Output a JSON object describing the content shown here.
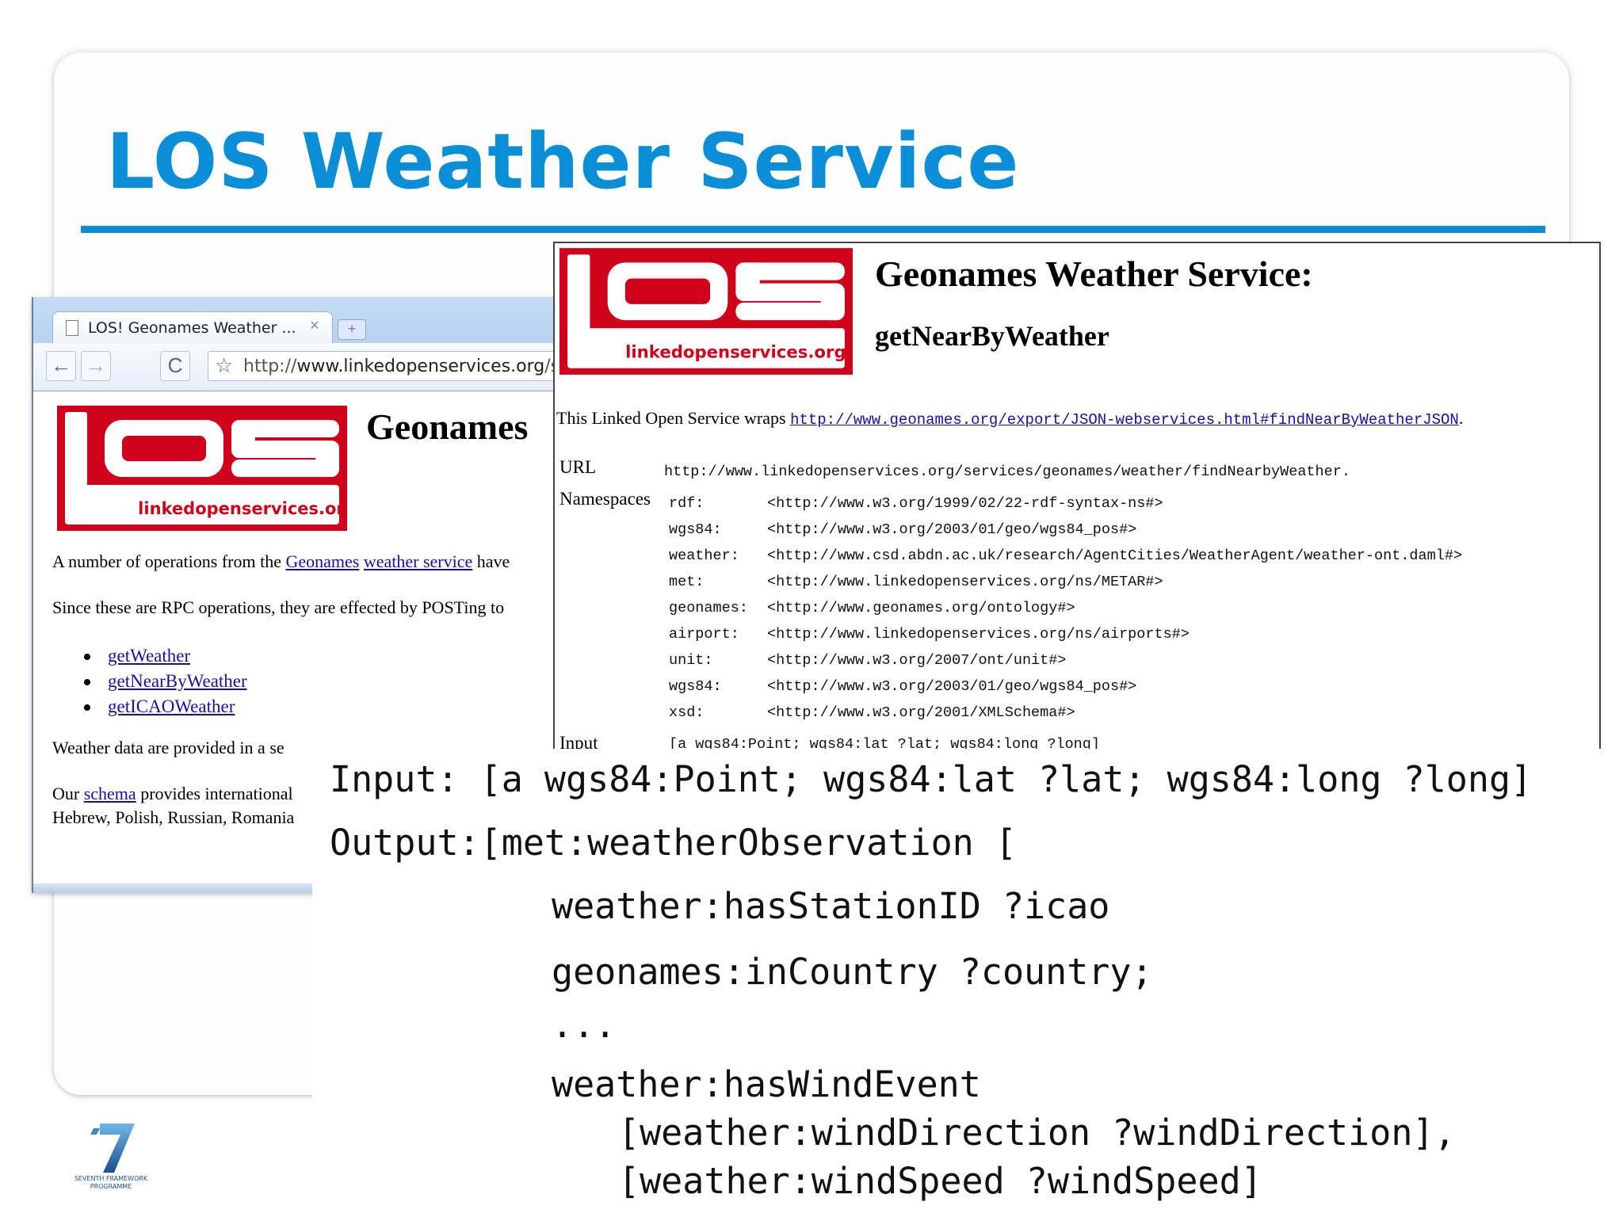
{
  "slide": {
    "title": "LOS Weather Service"
  },
  "browser": {
    "tab_title": "LOS! Geonames Weather ...",
    "tab_close": "×",
    "new_tab": "+",
    "back": "←",
    "forward": "→",
    "reload": "C",
    "star": "☆",
    "url_prefix": "http://",
    "url_domain": "www.linkedopenservices.org",
    "url_rest": "/servic",
    "page_heading": "Geonames",
    "logo_text": "linkedopenservices.org",
    "para1_start": "A number of operations from the ",
    "para1_link1": "Geonames",
    "para1_link2": "weather service",
    "para1_end": " have",
    "para2": "Since these are RPC operations, they are effected by POSTing to",
    "operations": [
      "getWeather",
      "getNearByWeather",
      "getICAOWeather"
    ],
    "para3": "Weather data are provided in a se",
    "para4_start": "Our ",
    "para4_link": "schema",
    "para4_end": " provides international",
    "para5": "Hebrew, Polish, Russian, Romania"
  },
  "doc": {
    "logo_text": "linkedopenservices.org",
    "title": "Geonames Weather Service:",
    "subtitle": "getNearByWeather",
    "wraps_text": "This Linked Open Service wraps ",
    "wraps_link": "http://www.geonames.org/export/JSON-webservices.html#findNearByWeatherJSON",
    "wraps_end": ".",
    "url_label": "URL",
    "url_value": "http://www.linkedopenservices.org/services/geonames/weather/findNearbyWeather.",
    "ns_label": "Namespaces",
    "namespaces": [
      {
        "prefix": "rdf:",
        "uri": "<http://www.w3.org/1999/02/22-rdf-syntax-ns#>"
      },
      {
        "prefix": "wgs84:",
        "uri": "<http://www.w3.org/2003/01/geo/wgs84_pos#>"
      },
      {
        "prefix": "weather:",
        "uri": "<http://www.csd.abdn.ac.uk/research/AgentCities/WeatherAgent/weather-ont.daml#>"
      },
      {
        "prefix": "met:",
        "uri": "<http://www.linkedopenservices.org/ns/METAR#>"
      },
      {
        "prefix": "geonames:",
        "uri": "<http://www.geonames.org/ontology#>"
      },
      {
        "prefix": "airport:",
        "uri": "<http://www.linkedopenservices.org/ns/airports#>"
      },
      {
        "prefix": "unit:",
        "uri": "<http://www.w3.org/2007/ont/unit#>"
      },
      {
        "prefix": "wgs84:",
        "uri": "<http://www.w3.org/2003/01/geo/wgs84_pos#>"
      },
      {
        "prefix": "xsd:",
        "uri": "<http://www.w3.org/2001/XMLSchema#>"
      }
    ],
    "input_label": "Input",
    "input_value": "[a wgs84:Point; wgs84:lat ?lat; wgs84:long ?long]"
  },
  "code": {
    "lines": [
      "Input: [a wgs84:Point; wgs84:lat ?lat; wgs84:long ?long]",
      "Output:[met:weatherObservation [",
      "weather:hasStationID ?icao",
      "geonames:inCountry ?country;",
      "...",
      "weather:hasWindEvent",
      "[weather:windDirection ?windDirection],",
      "[weather:windSpeed ?windSpeed]"
    ]
  },
  "footer": {
    "fp7_line1": "SEVENTH FRAMEWORK",
    "fp7_line2": "PROGRAMME"
  },
  "colors": {
    "accent": "#0a8fd6",
    "los_red": "#d0021b",
    "link": "#1a0dab"
  }
}
